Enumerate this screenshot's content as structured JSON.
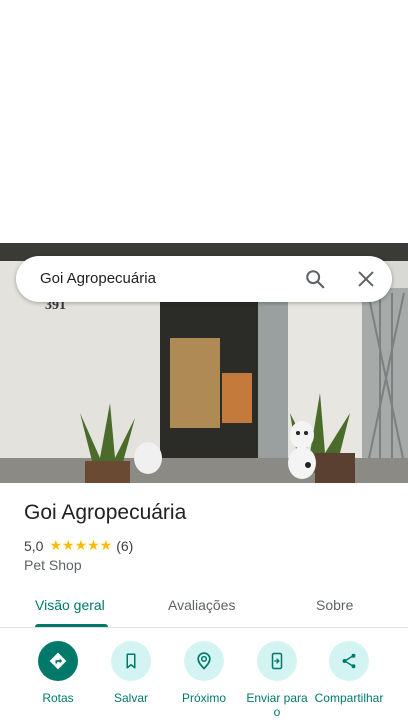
{
  "search": {
    "query": "Goi Agropecuária"
  },
  "photo": {
    "house_number": "391"
  },
  "place": {
    "name": "Goi Agropecuária",
    "rating": "5,0",
    "stars": "★★★★★",
    "review_count": "(6)",
    "category": "Pet Shop"
  },
  "tabs": [
    "Visão geral",
    "Avaliações",
    "Sobre"
  ],
  "actions": [
    {
      "label": "Rotas",
      "icon": "directions-icon"
    },
    {
      "label": "Salvar",
      "icon": "bookmark-icon"
    },
    {
      "label": "Próximo",
      "icon": "nearby-icon"
    },
    {
      "label": "Enviar para o",
      "icon": "send-to-phone-icon"
    },
    {
      "label": "Compartilhar",
      "icon": "share-icon"
    }
  ],
  "colors": {
    "accent": "#00796b",
    "chip": "#d3f4f2",
    "star": "#fbbc04"
  }
}
